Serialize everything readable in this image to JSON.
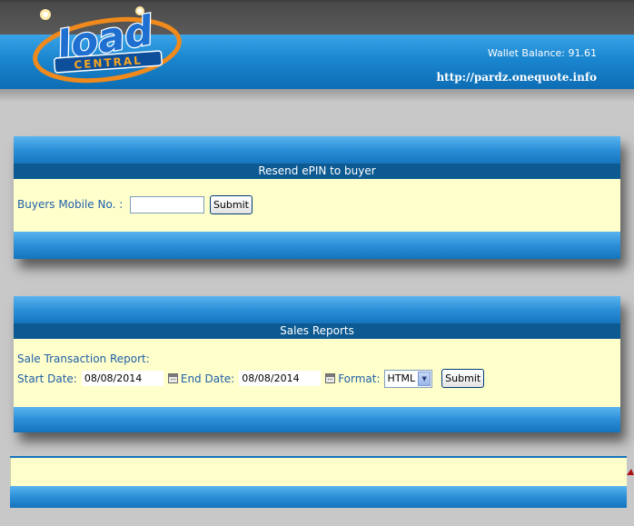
{
  "header": {
    "logo_top": "load",
    "logo_bottom": "CENTRAL",
    "wallet_label": "Wallet Balance: 91.61",
    "site_url": "http://pardz.onequote.info"
  },
  "resend_panel": {
    "title": "Resend ePIN to buyer",
    "mobile_label": "Buyers Mobile No. :",
    "mobile_value": "",
    "submit_label": "Submit"
  },
  "sales_panel": {
    "title": "Sales Reports",
    "report_label": "Sale Transaction Report:",
    "start_label": "Start Date:",
    "start_value": "08/08/2014",
    "end_label": "End Date:",
    "end_value": "08/08/2014",
    "format_label": "Format:",
    "format_value": "HTML",
    "submit_label": "Submit"
  },
  "colors": {
    "header_blue": "#1a86cf",
    "title_strip": "#0d5a92",
    "panel_body": "#ffffcc",
    "label_text": "#1f5fa8"
  }
}
